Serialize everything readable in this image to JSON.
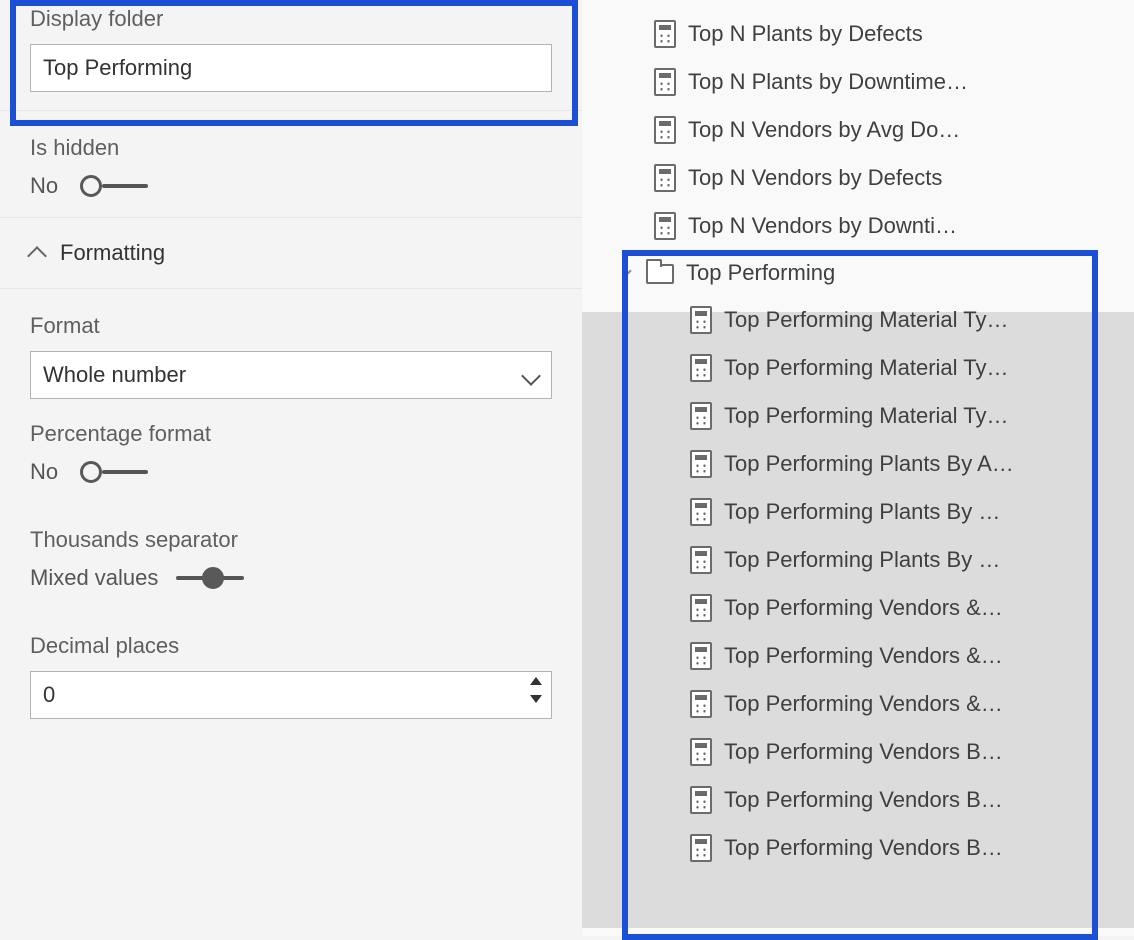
{
  "props": {
    "display_folder": {
      "label": "Display folder",
      "value": "Top Performing"
    },
    "is_hidden": {
      "label": "Is hidden",
      "value": "No"
    },
    "format": {
      "label": "Format",
      "value": "Whole number"
    },
    "percentage_format": {
      "label": "Percentage format",
      "value": "No"
    },
    "thousands_separator": {
      "label": "Thousands separator",
      "value": "Mixed values"
    },
    "decimal_places": {
      "label": "Decimal places",
      "value": "0"
    }
  },
  "section_header": "Formatting",
  "tree": {
    "top_items": [
      "Top N Plants by Defects",
      "Top N Plants by Downtime…",
      "Top N Vendors by Avg Do…",
      "Top N Vendors by Defects",
      "Top N Vendors by Downti…"
    ],
    "folder_name": "Top Performing",
    "folder_items": [
      "Top Performing Material Ty…",
      "Top Performing Material Ty…",
      "Top Performing Material Ty…",
      "Top Performing Plants By A…",
      "Top Performing Plants By …",
      "Top Performing Plants By …",
      "Top Performing Vendors &…",
      "Top Performing Vendors &…",
      "Top Performing Vendors &…",
      "Top Performing Vendors B…",
      "Top Performing Vendors B…",
      "Top Performing Vendors B…"
    ]
  }
}
